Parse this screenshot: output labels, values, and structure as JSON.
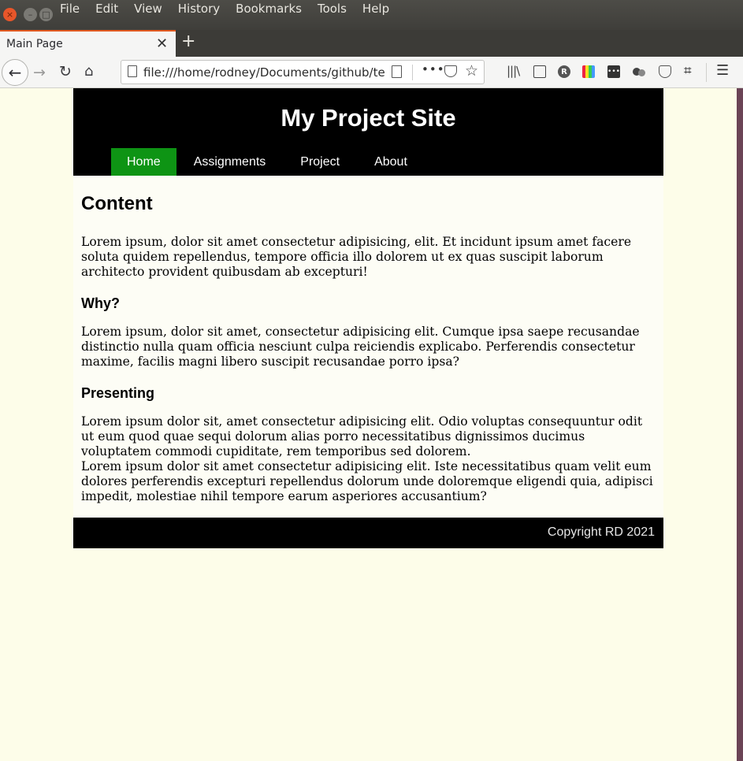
{
  "menubar": {
    "items": [
      "File",
      "Edit",
      "View",
      "History",
      "Bookmarks",
      "Tools",
      "Help"
    ]
  },
  "tabs": [
    {
      "title": "Main Page"
    }
  ],
  "urlbar": {
    "url": "file:///home/rodney/Documents/github/template/index.html"
  },
  "site": {
    "title": "My Project Site",
    "nav": [
      "Home",
      "Assignments",
      "Project",
      "About"
    ],
    "active_nav": "Home",
    "content_heading": "Content",
    "intro": "Lorem ipsum, dolor sit amet consectetur adipisicing, elit. Et incidunt ipsum amet facere soluta quidem repellendus, tempore officia illo dolorem ut ex quas suscipit laborum architecto provident quibusdam ab excepturi!",
    "why_heading": "Why?",
    "why_text": "Lorem ipsum, dolor sit amet, consectetur adipisicing elit. Cumque ipsa saepe recusandae distinctio nulla quam officia nesciunt culpa reiciendis explicabo. Perferendis consectetur maxime, facilis magni libero suscipit recusandae porro ipsa?",
    "presenting_heading": "Presenting",
    "presenting_text_1": "Lorem ipsum dolor sit, amet consectetur adipisicing elit. Odio voluptas consequuntur odit ut eum quod quae sequi dolorum alias porro necessitatibus dignissimos ducimus voluptatem commodi cupiditate, rem temporibus sed dolorem.",
    "presenting_text_2": "Lorem ipsum dolor sit amet consectetur adipisicing elit. Iste necessitatibus quam velit eum dolores perferendis excepturi repellendus dolorum unde doloremque eligendi quia, adipisci impedit, molestiae nihil tempore earum asperiores accusantium?",
    "footer": "Copyright RD 2021"
  },
  "colors": {
    "header_bg": "#000000",
    "nav_active": "#0e9414",
    "page_bg": "#fdfde9"
  }
}
